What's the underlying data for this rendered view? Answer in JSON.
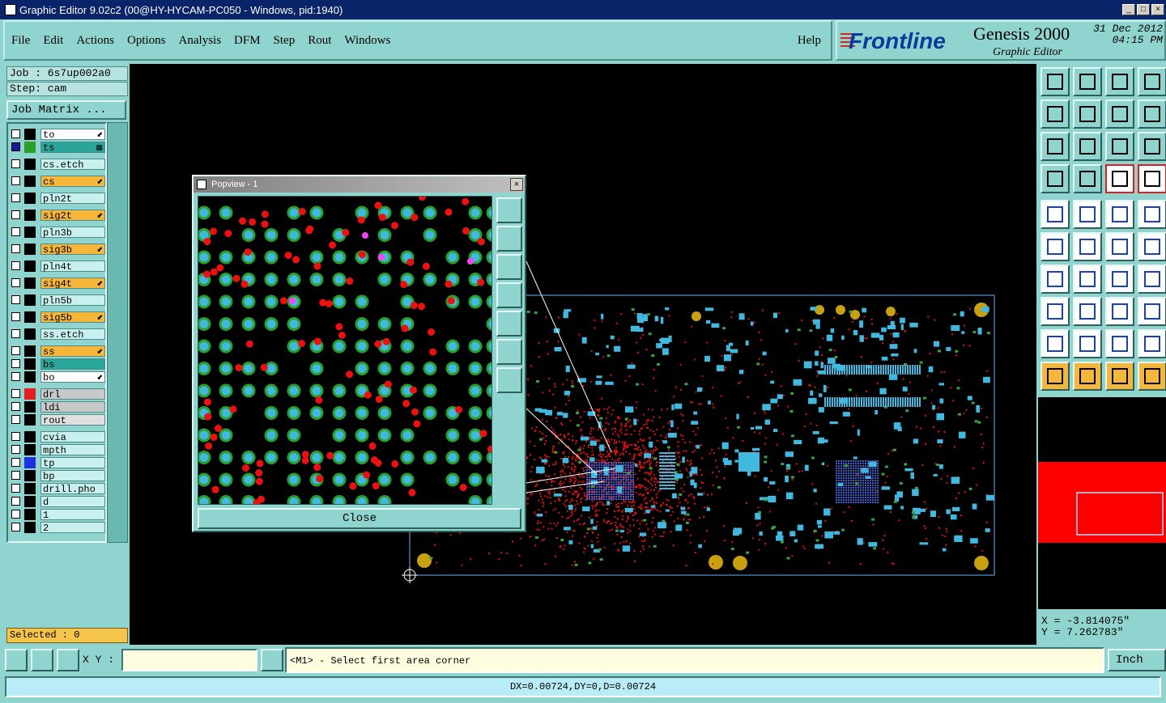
{
  "window": {
    "title": "Graphic Editor 9.02c2 (00@HY-HYCAM-PC050 - Windows, pid:1940)"
  },
  "menu": {
    "items": [
      "File",
      "Edit",
      "Actions",
      "Options",
      "Analysis",
      "DFM",
      "Step",
      "Rout",
      "Windows"
    ],
    "help": "Help"
  },
  "brand": {
    "logo": "Frontline",
    "product": "Genesis 2000",
    "subtitle": "Graphic Editor",
    "date": "31 Dec 2012",
    "time": "04:15 PM"
  },
  "job": {
    "job_label": "Job : 6s7up002a0",
    "step_label": "Step: cam",
    "matrix_button": "Job Matrix ..."
  },
  "layers": [
    {
      "name": "to",
      "swatch": "#000000",
      "bg": "#ffffff",
      "marker": "⬋"
    },
    {
      "name": "ts",
      "swatch": "#2aa02a",
      "bg": "#2aa59a",
      "marker": "▦",
      "active": true
    },
    {
      "name": "cs.etch",
      "swatch": "#000000",
      "bg": "#c8f0ee"
    },
    {
      "name": "cs",
      "swatch": "#000000",
      "bg": "#f5b63a",
      "marker": "⬋"
    },
    {
      "name": "pln2t",
      "swatch": "#000000",
      "bg": "#c8f0ee"
    },
    {
      "name": "sig2t",
      "swatch": "#000000",
      "bg": "#f5b63a",
      "marker": "⬋"
    },
    {
      "name": "pln3b",
      "swatch": "#000000",
      "bg": "#c8f0ee"
    },
    {
      "name": "sig3b",
      "swatch": "#000000",
      "bg": "#f5b63a",
      "marker": "⬋"
    },
    {
      "name": "pln4t",
      "swatch": "#000000",
      "bg": "#c8f0ee"
    },
    {
      "name": "sig4t",
      "swatch": "#000000",
      "bg": "#f5b63a",
      "marker": "⬋"
    },
    {
      "name": "pln5b",
      "swatch": "#000000",
      "bg": "#c8f0ee"
    },
    {
      "name": "sig5b",
      "swatch": "#000000",
      "bg": "#f5b63a",
      "marker": "⬋"
    },
    {
      "name": "ss.etch",
      "swatch": "#000000",
      "bg": "#c8f0ee"
    },
    {
      "name": "ss",
      "swatch": "#000000",
      "bg": "#f5b63a",
      "marker": "⬋"
    },
    {
      "name": "bs",
      "swatch": "#000000",
      "bg": "#2aa59a"
    },
    {
      "name": "bo",
      "swatch": "#000000",
      "bg": "#ffffff",
      "marker": "⬋"
    },
    {
      "name": "drl",
      "swatch": "#e02020",
      "bg": "#c8c8c8"
    },
    {
      "name": "ldi",
      "swatch": "#000000",
      "bg": "#c8c8c8"
    },
    {
      "name": "rout",
      "swatch": "#000000",
      "bg": "#e0e0e0"
    },
    {
      "name": "cvia",
      "swatch": "#000000",
      "bg": "#c8f0ee"
    },
    {
      "name": "mpth",
      "swatch": "#000000",
      "bg": "#c8f0ee"
    },
    {
      "name": "tp",
      "swatch": "#2030e0",
      "bg": "#c8f0ee"
    },
    {
      "name": "bp",
      "swatch": "#000000",
      "bg": "#c8f0ee"
    },
    {
      "name": "drill.pho",
      "swatch": "#000000",
      "bg": "#c8f0ee"
    },
    {
      "name": "d",
      "swatch": "#000000",
      "bg": "#c8f0ee"
    },
    {
      "name": "1",
      "swatch": "#000000",
      "bg": "#c8f0ee"
    },
    {
      "name": "2",
      "swatch": "#000000",
      "bg": "#c8f0ee"
    }
  ],
  "selected": "Selected : 0",
  "popview": {
    "title": "Popview - 1",
    "close": "Close"
  },
  "coords": {
    "x": "X = -3.814075\"",
    "y": "Y = 7.262783\""
  },
  "cmd": {
    "xy_label": "X Y :",
    "xy_value": "",
    "prompt": "<M1> - Select first area corner",
    "unit": "Inch"
  },
  "measure": "DX=0.00724,DY=0,D=0.00724",
  "colors": {
    "bg": "#8fd4cf",
    "canvas": "#000000",
    "pad": "#40b8e0",
    "pad_ring": "#2aa02a",
    "via": "#e01010",
    "outline": "#6ab0ff"
  }
}
